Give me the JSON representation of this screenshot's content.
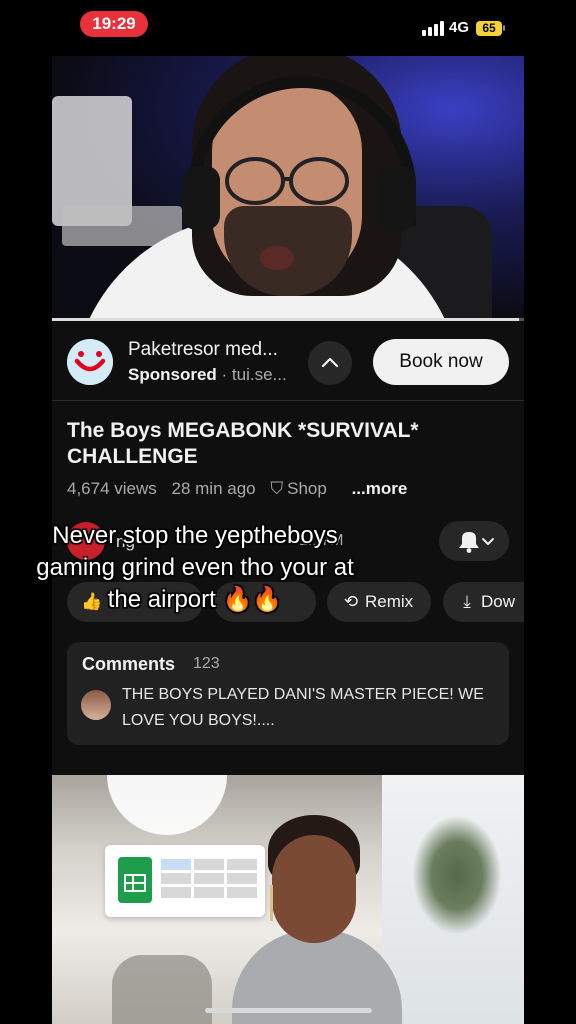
{
  "status_bar": {
    "time": "19:29",
    "network": "4G",
    "battery": "65"
  },
  "video_progress": 0.99,
  "ad": {
    "title": "Paketresor med...",
    "sponsored_label": "Sponsored",
    "domain": "· tui.se...",
    "cta": "Book now",
    "logo": "tui-smile-logo"
  },
  "video": {
    "title": "The Boys MEGABONK *SURVIVAL* CHALLENGE",
    "views": "4,674 views",
    "age": "28 min ago",
    "shop_label": "Shop",
    "more_label": "...more"
  },
  "channel": {
    "name_partial": "ng",
    "subscribers": "1.17M"
  },
  "actions": [
    {
      "label": "",
      "icon": "like-icon"
    },
    {
      "label": "",
      "icon": "share-icon"
    },
    {
      "label": "Remix",
      "icon": "remix-icon"
    },
    {
      "label": "Dow",
      "icon": "download-icon"
    }
  ],
  "comments": {
    "header": "Comments",
    "count": "123",
    "top_comment": "THE BOYS PLAYED DANI'S MASTER PIECE! WE LOVE YOU BOYS!...."
  },
  "overlay_caption": "Never stop the yeptheboys gaming grind even tho your at the airport 🔥🔥",
  "colors": {
    "status_pill": "#e8323b",
    "battery": "#f4d23c",
    "background": "#0f0f0f"
  }
}
